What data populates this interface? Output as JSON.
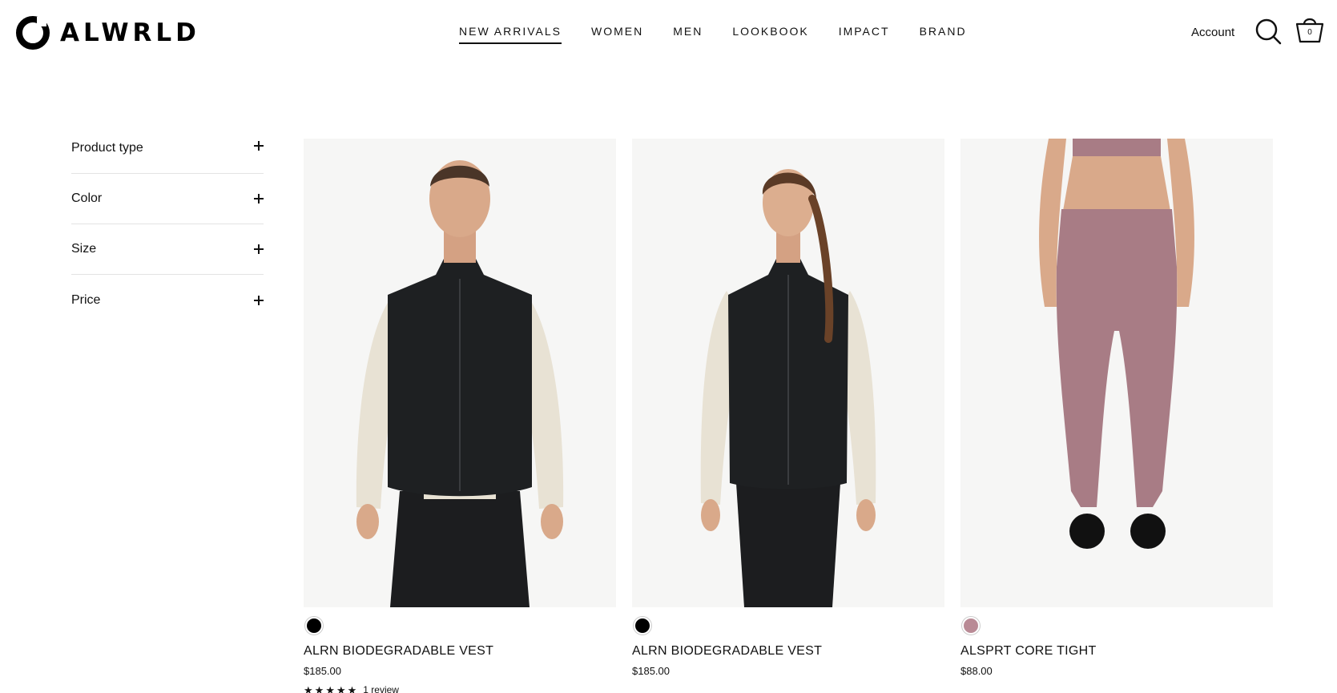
{
  "header": {
    "logo_text": "ALWRLD",
    "nav": [
      {
        "label": "NEW ARRIVALS",
        "active": true
      },
      {
        "label": "WOMEN",
        "active": false
      },
      {
        "label": "MEN",
        "active": false
      },
      {
        "label": "LOOKBOOK",
        "active": false
      },
      {
        "label": "IMPACT",
        "active": false
      },
      {
        "label": "BRAND",
        "active": false
      }
    ],
    "account_label": "Account",
    "cart_count": "0",
    "icons": {
      "search": "search-icon",
      "cart": "cart-icon"
    }
  },
  "filters": [
    {
      "label": "Product type",
      "icon": "plus-icon"
    },
    {
      "label": "Color",
      "icon": "plus-icon"
    },
    {
      "label": "Size",
      "icon": "plus-icon"
    },
    {
      "label": "Price",
      "icon": "plus-icon"
    }
  ],
  "products": [
    {
      "name": "ALRN BIODEGRADABLE VEST",
      "price": "$185.00",
      "swatch_color": "#000000",
      "rating": 5,
      "review_text": "1 review"
    },
    {
      "name": "ALRN BIODEGRADABLE VEST",
      "price": "$185.00",
      "swatch_color": "#000000"
    },
    {
      "name": "ALSPRT CORE TIGHT",
      "price": "$88.00",
      "swatch_color": "#b98a95"
    }
  ],
  "colors": {
    "text": "#111111",
    "divider": "#e3e3e3",
    "vest": "#1e2022",
    "tight": "#a87c85",
    "sleeve": "#e9e3d6"
  }
}
